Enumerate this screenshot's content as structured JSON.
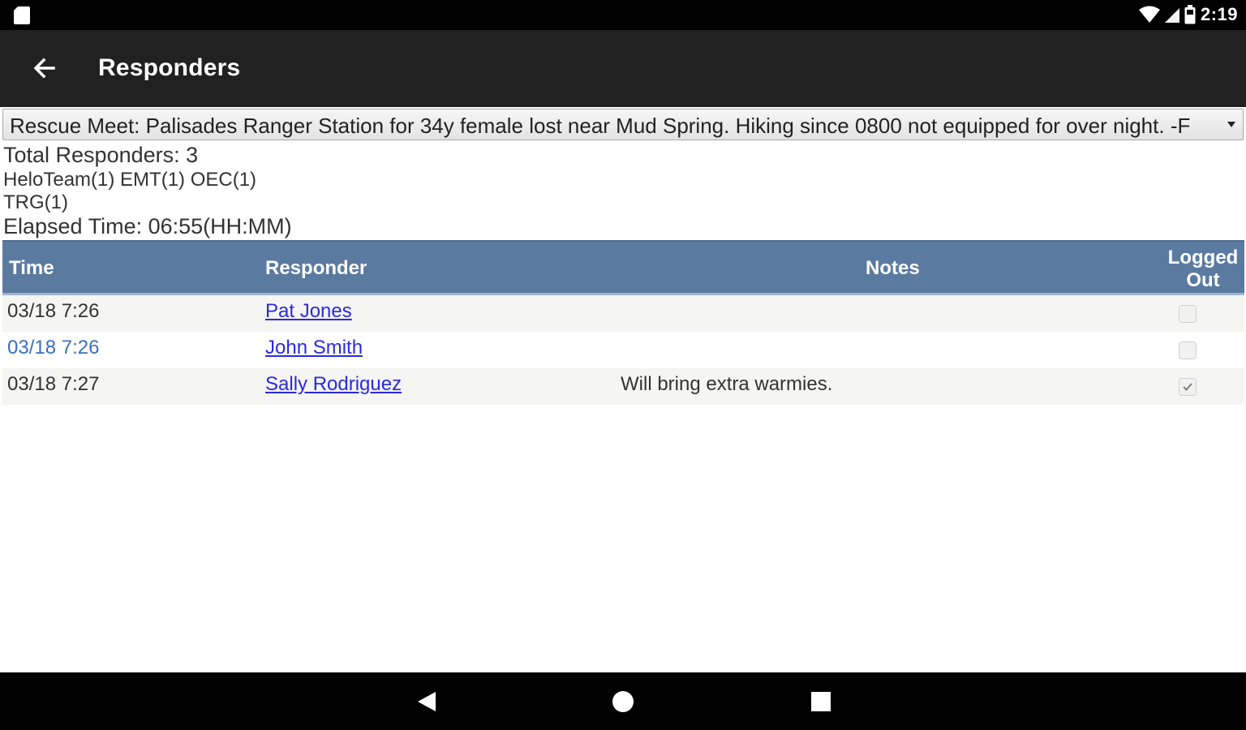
{
  "status_bar": {
    "time": "2:19",
    "icons": [
      "sd-card-icon",
      "wifi-icon",
      "signal-icon",
      "battery-icon"
    ]
  },
  "app_bar": {
    "title": "Responders",
    "back_icon": "arrow-left-icon"
  },
  "event_select": {
    "selected": "Rescue Meet: Palisades Ranger Station for 34y female lost near Mud Spring. Hiking since 0800 not equipped for over night. -F"
  },
  "summary": {
    "total": "Total Responders: 3",
    "teams_line_1": "HeloTeam(1) EMT(1) OEC(1)",
    "teams_line_2": "TRG(1)",
    "elapsed": "Elapsed Time: 06:55(HH:MM)"
  },
  "table": {
    "headers": {
      "time": "Time",
      "responder": "Responder",
      "notes": "Notes",
      "logged_out_1": "Logged",
      "logged_out_2": "Out"
    },
    "rows": [
      {
        "time": "03/18 7:26",
        "responder": "Pat Jones",
        "notes": "",
        "logged_out": false
      },
      {
        "time": "03/18 7:26",
        "responder": "John Smith",
        "notes": "",
        "logged_out": false
      },
      {
        "time": "03/18 7:27",
        "responder": "Sally Rodriguez",
        "notes": "Will bring extra warmies.",
        "logged_out": true
      }
    ]
  },
  "nav_bar": {
    "icons": [
      "nav-back-icon",
      "nav-home-icon",
      "nav-recents-icon"
    ]
  },
  "colors": {
    "header_bg": "#5b7aa0",
    "app_bar_bg": "#212121",
    "link": "#2a2ae0"
  }
}
